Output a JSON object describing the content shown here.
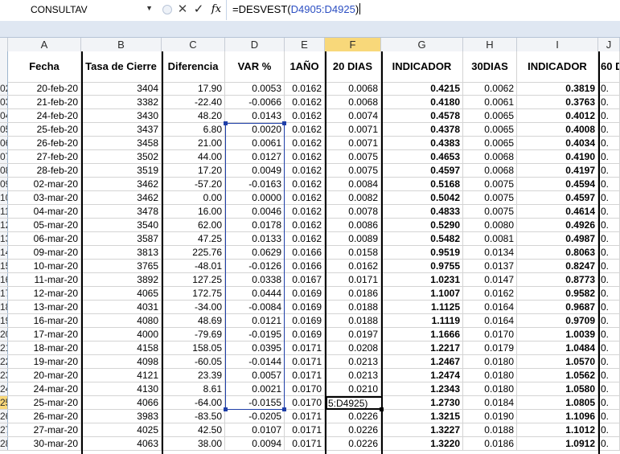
{
  "formula_bar": {
    "name_box": "CONSULTAV",
    "cancel_icon": "✕",
    "enter_icon": "✓",
    "fx_label": "fx",
    "formula_prefix": "=DESVEST(",
    "formula_ref": "D4905:D4925",
    "formula_suffix": ")"
  },
  "columns": [
    "A",
    "B",
    "C",
    "D",
    "E",
    "F",
    "G",
    "H",
    "I",
    "J"
  ],
  "headers": [
    "Fecha",
    "Tasa de Cierre",
    "Diferencia",
    "VAR %",
    "1AÑO",
    "20 DIAS",
    "INDICADOR",
    "30DIAS",
    "INDICADOR",
    "60 D"
  ],
  "rows": [
    {
      "n": "02",
      "c": [
        "20-feb-20",
        "3404",
        "17.90",
        "0.0053",
        "0.0162",
        "0.0068",
        "0.4215",
        "0.0062",
        "0.3819",
        "0."
      ]
    },
    {
      "n": "03",
      "c": [
        "21-feb-20",
        "3382",
        "-22.40",
        "-0.0066",
        "0.0162",
        "0.0068",
        "0.4180",
        "0.0061",
        "0.3763",
        "0."
      ]
    },
    {
      "n": "04",
      "c": [
        "24-feb-20",
        "3430",
        "48.20",
        "0.0143",
        "0.0162",
        "0.0074",
        "0.4578",
        "0.0065",
        "0.4012",
        "0."
      ]
    },
    {
      "n": "05",
      "c": [
        "25-feb-20",
        "3437",
        "6.80",
        "0.0020",
        "0.0162",
        "0.0071",
        "0.4378",
        "0.0065",
        "0.4008",
        "0."
      ]
    },
    {
      "n": "06",
      "c": [
        "26-feb-20",
        "3458",
        "21.00",
        "0.0061",
        "0.0162",
        "0.0071",
        "0.4383",
        "0.0065",
        "0.4034",
        "0."
      ]
    },
    {
      "n": "07",
      "c": [
        "27-feb-20",
        "3502",
        "44.00",
        "0.0127",
        "0.0162",
        "0.0075",
        "0.4653",
        "0.0068",
        "0.4190",
        "0."
      ]
    },
    {
      "n": "08",
      "c": [
        "28-feb-20",
        "3519",
        "17.20",
        "0.0049",
        "0.0162",
        "0.0075",
        "0.4597",
        "0.0068",
        "0.4197",
        "0."
      ]
    },
    {
      "n": "09",
      "c": [
        "02-mar-20",
        "3462",
        "-57.20",
        "-0.0163",
        "0.0162",
        "0.0084",
        "0.5168",
        "0.0075",
        "0.4594",
        "0."
      ]
    },
    {
      "n": "10",
      "c": [
        "03-mar-20",
        "3462",
        "0.00",
        "0.0000",
        "0.0162",
        "0.0082",
        "0.5042",
        "0.0075",
        "0.4597",
        "0."
      ]
    },
    {
      "n": "11",
      "c": [
        "04-mar-20",
        "3478",
        "16.00",
        "0.0046",
        "0.0162",
        "0.0078",
        "0.4833",
        "0.0075",
        "0.4614",
        "0."
      ]
    },
    {
      "n": "12",
      "c": [
        "05-mar-20",
        "3540",
        "62.00",
        "0.0178",
        "0.0162",
        "0.0086",
        "0.5290",
        "0.0080",
        "0.4926",
        "0."
      ]
    },
    {
      "n": "13",
      "c": [
        "06-mar-20",
        "3587",
        "47.25",
        "0.0133",
        "0.0162",
        "0.0089",
        "0.5482",
        "0.0081",
        "0.4987",
        "0."
      ]
    },
    {
      "n": "14",
      "c": [
        "09-mar-20",
        "3813",
        "225.76",
        "0.0629",
        "0.0166",
        "0.0158",
        "0.9519",
        "0.0134",
        "0.8063",
        "0."
      ]
    },
    {
      "n": "15",
      "c": [
        "10-mar-20",
        "3765",
        "-48.01",
        "-0.0126",
        "0.0166",
        "0.0162",
        "0.9755",
        "0.0137",
        "0.8247",
        "0."
      ]
    },
    {
      "n": "16",
      "c": [
        "11-mar-20",
        "3892",
        "127.25",
        "0.0338",
        "0.0167",
        "0.0171",
        "1.0231",
        "0.0147",
        "0.8773",
        "0."
      ]
    },
    {
      "n": "17",
      "c": [
        "12-mar-20",
        "4065",
        "172.75",
        "0.0444",
        "0.0169",
        "0.0186",
        "1.1007",
        "0.0162",
        "0.9582",
        "0."
      ]
    },
    {
      "n": "18",
      "c": [
        "13-mar-20",
        "4031",
        "-34.00",
        "-0.0084",
        "0.0169",
        "0.0188",
        "1.1125",
        "0.0164",
        "0.9687",
        "0."
      ]
    },
    {
      "n": "19",
      "c": [
        "16-mar-20",
        "4080",
        "48.69",
        "0.0121",
        "0.0169",
        "0.0188",
        "1.1119",
        "0.0164",
        "0.9709",
        "0."
      ]
    },
    {
      "n": "20",
      "c": [
        "17-mar-20",
        "4000",
        "-79.69",
        "-0.0195",
        "0.0169",
        "0.0197",
        "1.1666",
        "0.0170",
        "1.0039",
        "0."
      ]
    },
    {
      "n": "21",
      "c": [
        "18-mar-20",
        "4158",
        "158.05",
        "0.0395",
        "0.0171",
        "0.0208",
        "1.2217",
        "0.0179",
        "1.0484",
        "0."
      ]
    },
    {
      "n": "22",
      "c": [
        "19-mar-20",
        "4098",
        "-60.05",
        "-0.0144",
        "0.0171",
        "0.0213",
        "1.2467",
        "0.0180",
        "1.0570",
        "0."
      ]
    },
    {
      "n": "23",
      "c": [
        "20-mar-20",
        "4121",
        "23.39",
        "0.0057",
        "0.0171",
        "0.0213",
        "1.2474",
        "0.0180",
        "1.0562",
        "0."
      ]
    },
    {
      "n": "24",
      "c": [
        "24-mar-20",
        "4130",
        "8.61",
        "0.0021",
        "0.0170",
        "0.0210",
        "1.2343",
        "0.0180",
        "1.0580",
        "0."
      ]
    },
    {
      "n": "25",
      "c": [
        "25-mar-20",
        "4066",
        "-64.00",
        "-0.0155",
        "0.0170",
        "5:D4925)",
        "1.2730",
        "0.0184",
        "1.0805",
        "0."
      ]
    },
    {
      "n": "26",
      "c": [
        "26-mar-20",
        "3983",
        "-83.50",
        "-0.0205",
        "0.0171",
        "0.0226",
        "1.3215",
        "0.0190",
        "1.1096",
        "0."
      ]
    },
    {
      "n": "27",
      "c": [
        "27-mar-20",
        "4025",
        "42.50",
        "0.0107",
        "0.0171",
        "0.0226",
        "1.3227",
        "0.0188",
        "1.1012",
        "0."
      ]
    },
    {
      "n": "28",
      "c": [
        "30-mar-20",
        "4063",
        "38.00",
        "0.0094",
        "0.0171",
        "0.0226",
        "1.3220",
        "0.0186",
        "1.0912",
        "0."
      ]
    }
  ]
}
